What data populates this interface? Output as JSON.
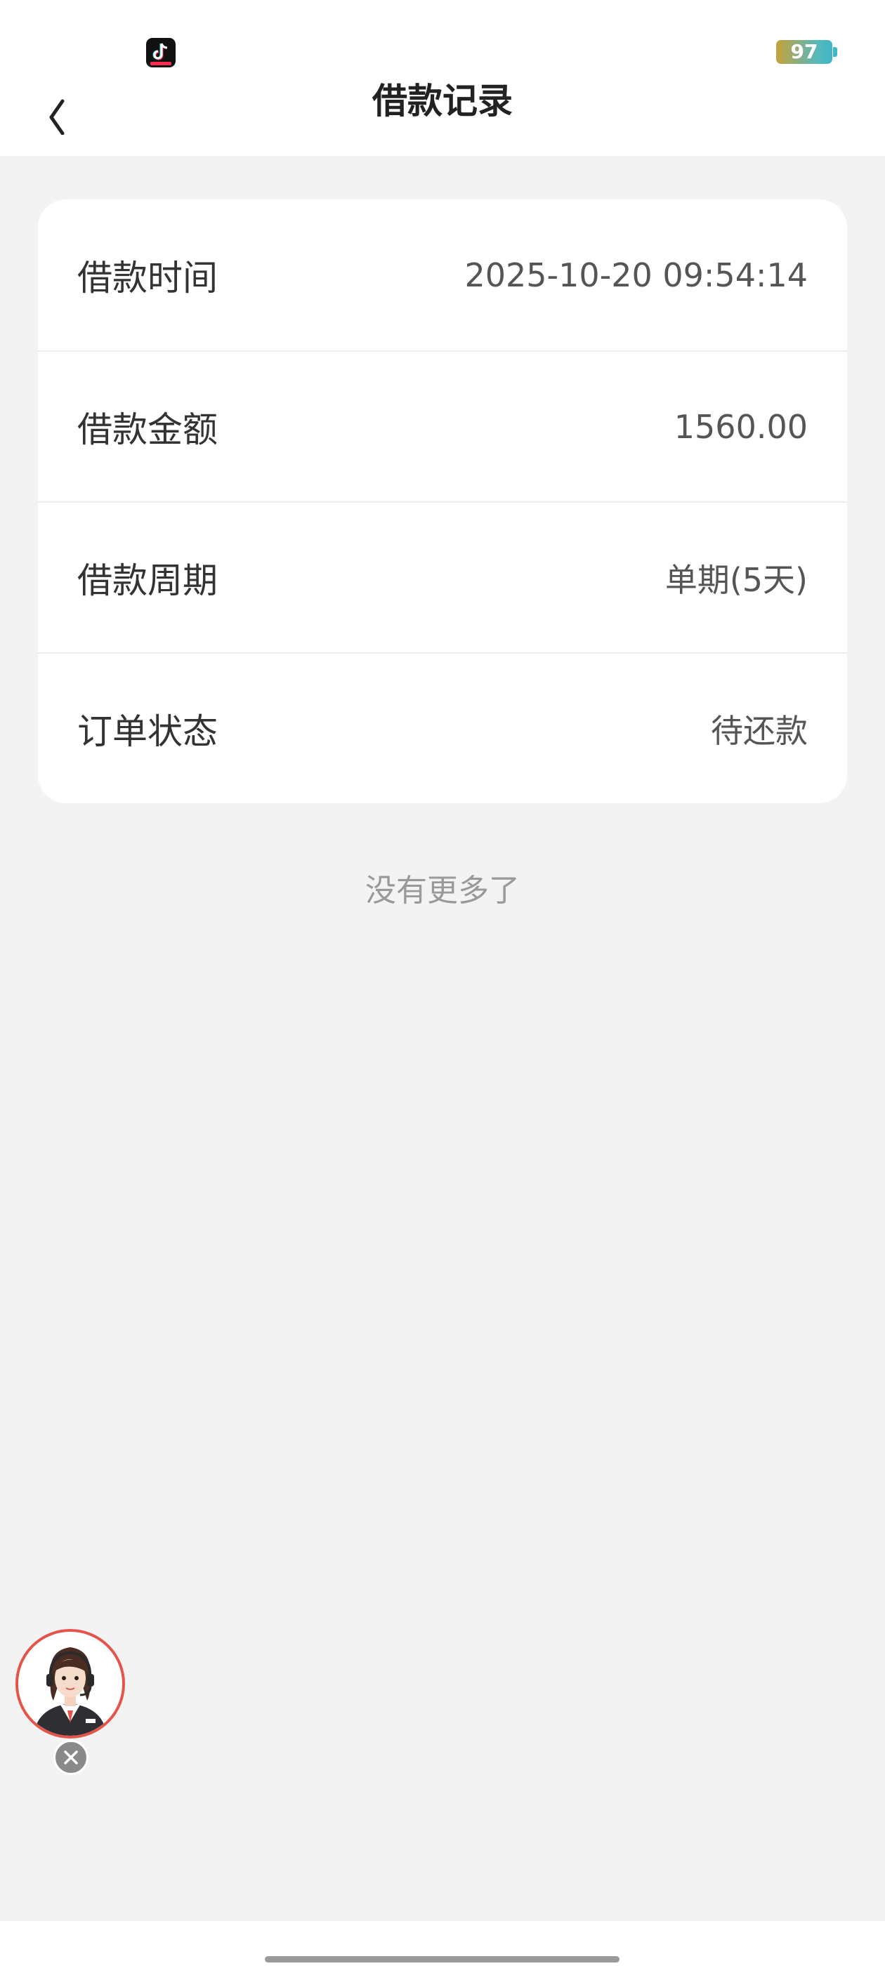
{
  "status_bar": {
    "app_icon": "tiktok-icon",
    "battery_level": "97"
  },
  "nav": {
    "back_icon": "chevron-left-icon",
    "title": "借款记录"
  },
  "record": {
    "rows": [
      {
        "label": "借款时间",
        "value": "2025-10-20 09:54:14"
      },
      {
        "label": "借款金额",
        "value": "1560.00"
      },
      {
        "label": "借款周期",
        "value": "单期(5天)"
      },
      {
        "label": "订单状态",
        "value": "待还款"
      }
    ]
  },
  "list_footer": "没有更多了",
  "floating": {
    "avatar_icon": "customer-service-agent-icon",
    "close_icon": "close-icon"
  },
  "colors": {
    "background": "#f3f3f3",
    "card": "#ffffff",
    "avatar_ring": "#e5534b"
  }
}
